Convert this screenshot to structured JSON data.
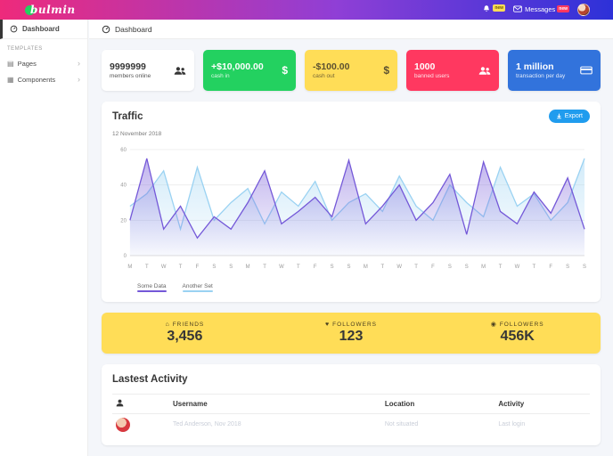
{
  "navbar": {
    "brand": "bulmin",
    "bell_badge": "new",
    "messages_label": "Messages",
    "messages_badge": "new"
  },
  "sidebar": {
    "dashboard_label": "Dashboard",
    "section_label": "TEMPLATES",
    "items": [
      {
        "label": "Pages"
      },
      {
        "label": "Components"
      }
    ]
  },
  "header": {
    "title": "Dashboard"
  },
  "stats": [
    {
      "value": "9999999",
      "label": "members online",
      "icon": "users"
    },
    {
      "value": "+$10,000.00",
      "label": "cash in",
      "icon": "dollar"
    },
    {
      "value": "-$100.00",
      "label": "cash out",
      "icon": "dollar"
    },
    {
      "value": "1000",
      "label": "banned users",
      "icon": "users"
    },
    {
      "value": "1 million",
      "label": "transaction per day",
      "icon": "credit-card"
    }
  ],
  "traffic": {
    "title": "Traffic",
    "date": "12 November 2018",
    "export_label": "Export"
  },
  "chart_data": {
    "type": "area",
    "title": "Traffic",
    "x": [
      "M",
      "T",
      "W",
      "T",
      "F",
      "S",
      "S",
      "M",
      "T",
      "W",
      "T",
      "F",
      "S",
      "S",
      "M",
      "T",
      "W",
      "T",
      "F",
      "S",
      "S",
      "M",
      "T",
      "W",
      "T",
      "F",
      "S",
      "S"
    ],
    "ylim": [
      0,
      60
    ],
    "yticks": [
      0,
      20,
      40,
      60
    ],
    "grid": "horizontal",
    "legend_position": "bottom-left",
    "series": [
      {
        "name": "Some Data",
        "color": "#7458d8",
        "values": [
          20,
          55,
          15,
          28,
          10,
          22,
          15,
          30,
          48,
          18,
          25,
          33,
          22,
          54,
          18,
          28,
          40,
          20,
          30,
          46,
          12,
          53,
          25,
          18,
          36,
          24,
          44,
          15
        ]
      },
      {
        "name": "Another Set",
        "color": "#9ad2f2",
        "values": [
          28,
          35,
          48,
          15,
          50,
          20,
          30,
          38,
          18,
          36,
          28,
          42,
          20,
          30,
          35,
          25,
          45,
          28,
          20,
          40,
          30,
          22,
          50,
          28,
          35,
          20,
          30,
          55
        ]
      }
    ]
  },
  "summary": [
    {
      "label": "FRIENDS",
      "value": "3,456",
      "icon": "bank"
    },
    {
      "label": "FOLLOWERS",
      "value": "123",
      "icon": "heart"
    },
    {
      "label": "FOLLOWERS",
      "value": "456K",
      "icon": "user"
    }
  ],
  "activity": {
    "title": "Lastest Activity",
    "columns": [
      "Username",
      "Location",
      "Activity"
    ],
    "rows": [
      {
        "username": "Ted Anderson, Nov 2018",
        "location": "Not situated",
        "activity": "Last login"
      }
    ]
  }
}
